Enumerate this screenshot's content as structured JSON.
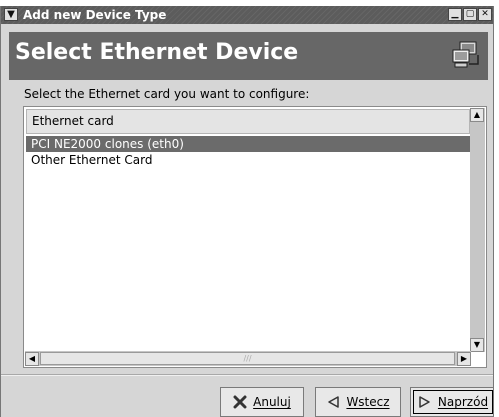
{
  "window": {
    "title": "Add new Device Type",
    "menu_icon": "chevron-down-icon",
    "minimize_icon": "minimize-icon",
    "maximize_icon": "maximize-icon",
    "close_icon": "close-icon"
  },
  "header": {
    "title": "Select Ethernet Device",
    "icon": "network-computers-icon"
  },
  "instruction": "Select the Ethernet card you want to configure:",
  "list": {
    "column_header": "Ethernet card",
    "rows": [
      {
        "label": "PCI NE2000 clones (eth0)",
        "selected": true
      },
      {
        "label": "Other Ethernet Card",
        "selected": false
      }
    ]
  },
  "buttons": {
    "cancel": "Anuluj",
    "back": "Wstecz",
    "next": "Naprzód"
  },
  "colors": {
    "titlebar": "#5c5c5c",
    "header_bg": "#676767",
    "selection": "#6b6b6b",
    "dialog_bg": "#d6d6d6"
  }
}
